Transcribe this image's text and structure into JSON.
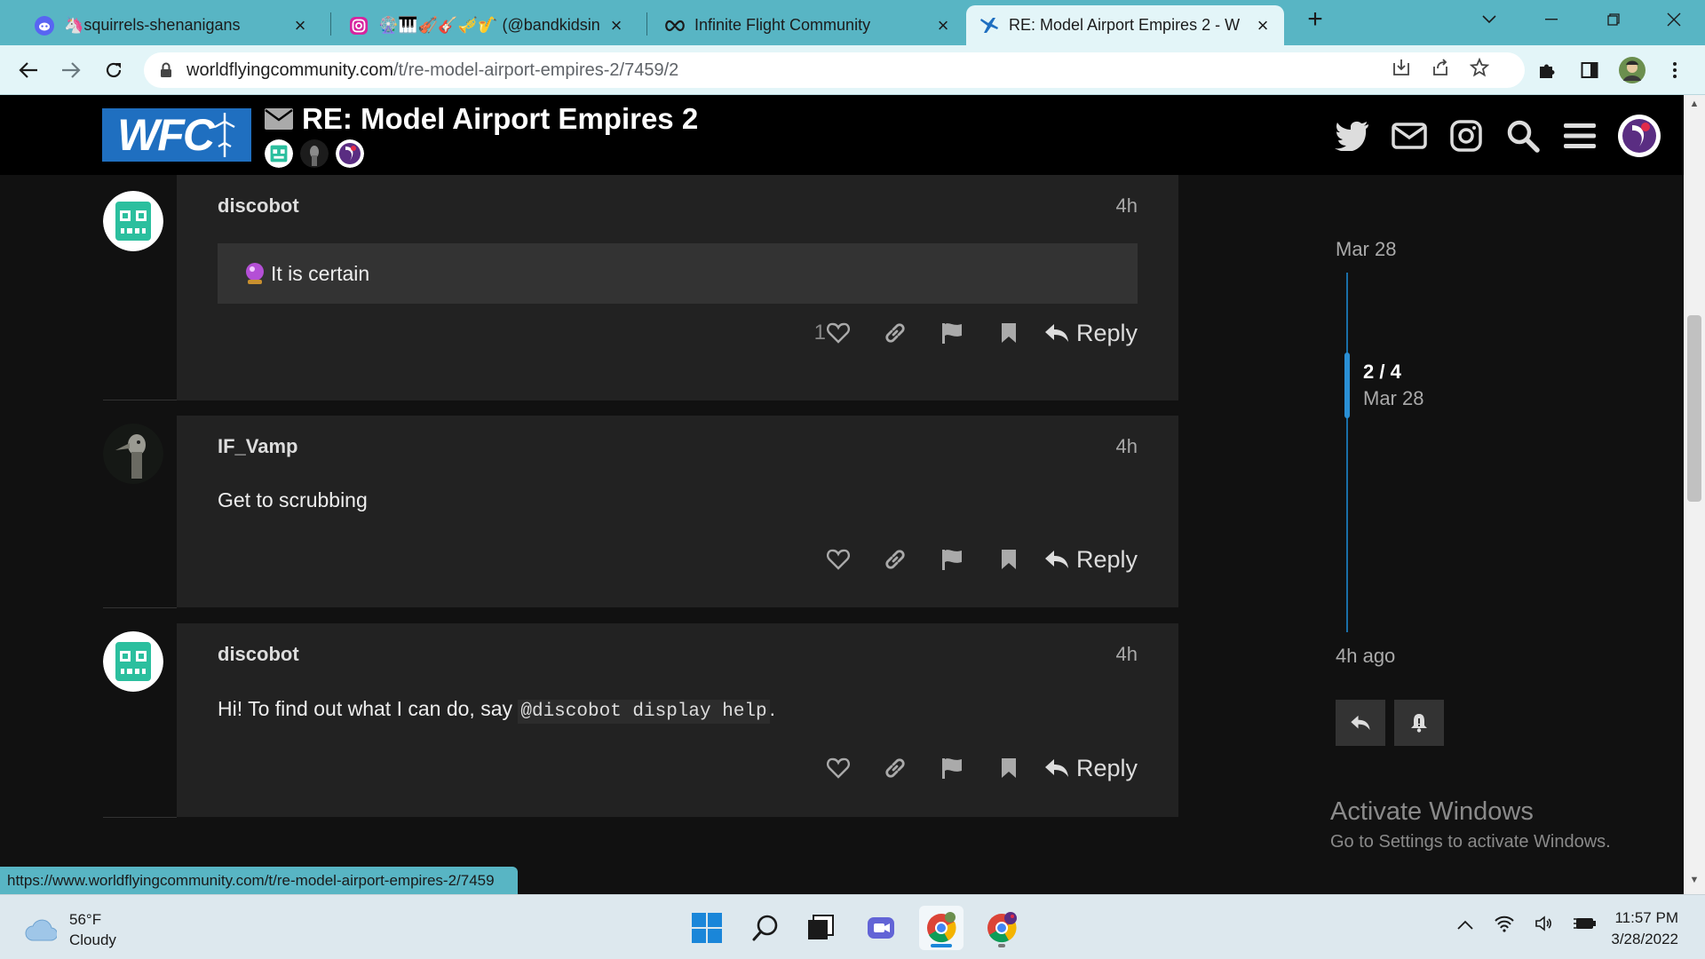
{
  "browser": {
    "tabs": [
      {
        "title": "🦄squirrels-shenanigans",
        "icon": "discord-icon",
        "active": false
      },
      {
        "title": "🎡🎹🎻🎸🎺🎷 (@bandkidsin",
        "icon": "instagram-icon",
        "active": false
      },
      {
        "title": "Infinite Flight Community",
        "icon": "infinity-icon",
        "active": false
      },
      {
        "title": "RE: Model Airport Empires 2 - W",
        "icon": "plane-icon",
        "active": true
      }
    ],
    "url_host": "worldflyingcommunity.com",
    "url_path": "/t/re-model-airport-empires-2/7459/2",
    "status_url": "https://www.worldflyingcommunity.com/t/re-model-airport-empires-2/7459"
  },
  "site": {
    "logo_text": "WFC",
    "topic_title": "RE: Model Airport Empires 2"
  },
  "posts": [
    {
      "username": "discobot",
      "time": "4h",
      "quote": "It is certain",
      "like_count": "1",
      "reply_label": "Reply"
    },
    {
      "username": "IF_Vamp",
      "time": "4h",
      "body": "Get to scrubbing",
      "reply_label": "Reply"
    },
    {
      "username": "discobot",
      "time": "4h",
      "body_prefix": "Hi! To find out what I can do, say ",
      "body_code": "@discobot display help",
      "body_suffix": ".",
      "reply_label": "Reply"
    }
  ],
  "timeline": {
    "start_date": "Mar 28",
    "position": "2 / 4",
    "position_date": "Mar 28",
    "end_label": "4h ago"
  },
  "watermark": {
    "line1": "Activate Windows",
    "line2": "Go to Settings to activate Windows."
  },
  "taskbar": {
    "temperature": "56°F",
    "condition": "Cloudy",
    "time": "11:57 PM",
    "date": "3/28/2022"
  },
  "colors": {
    "chrome_tab_bar": "#58b5c4",
    "active_tab": "#e3f5f8",
    "site_header": "#000000",
    "post_bg": "#222222",
    "timeline_accent": "#2a8fd4",
    "logo_blue": "#1f6fc0"
  }
}
